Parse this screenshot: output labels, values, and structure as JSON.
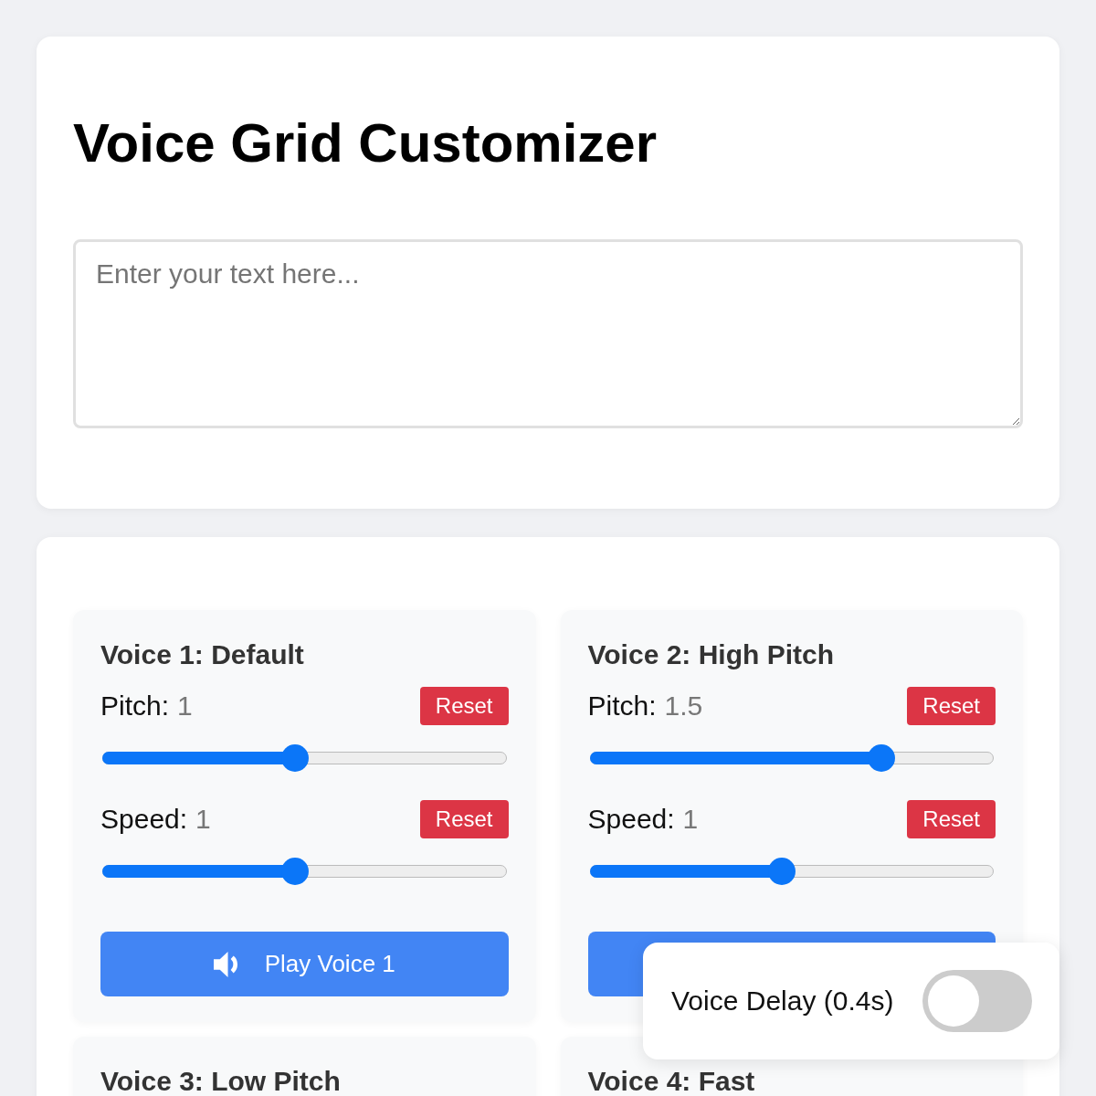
{
  "title": "Voice Grid Customizer",
  "text_input": {
    "placeholder": "Enter your text here..."
  },
  "voices": [
    {
      "title": "Voice 1: Default",
      "controls": [
        {
          "label": "Pitch:",
          "value": "1",
          "reset": "Reset",
          "level": 0.474
        },
        {
          "label": "Speed:",
          "value": "1",
          "reset": "Reset",
          "level": 0.474
        }
      ],
      "play_label": "Play Voice 1"
    },
    {
      "title": "Voice 2: High Pitch",
      "controls": [
        {
          "label": "Pitch:",
          "value": "1.5",
          "reset": "Reset",
          "level": 0.737
        },
        {
          "label": "Speed:",
          "value": "1",
          "reset": "Reset",
          "level": 0.474
        }
      ]
    },
    {
      "title": "Voice 3: Low Pitch"
    },
    {
      "title": "Voice 4: Fast"
    }
  ],
  "delay_toggle": {
    "label": "Voice Delay (0.4s)",
    "on": false
  }
}
